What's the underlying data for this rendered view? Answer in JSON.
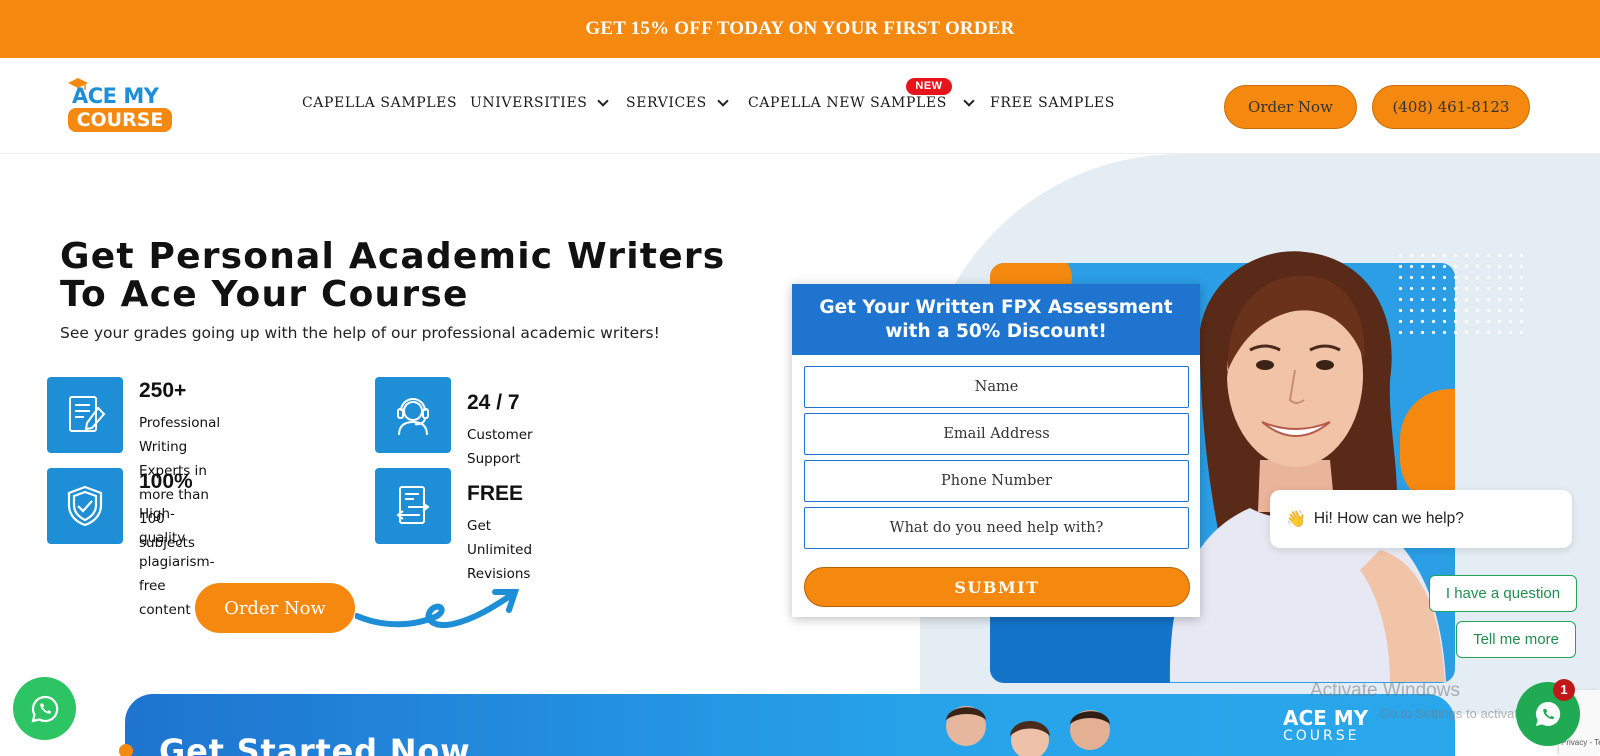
{
  "promo": {
    "text": "GET 15% OFF TODAY ON YOUR FIRST ORDER"
  },
  "logo": {
    "line1": "ACE MY",
    "line2": "COURSE"
  },
  "nav": {
    "items": [
      {
        "label": "CAPELLA SAMPLES",
        "dropdown": false
      },
      {
        "label": "UNIVERSITIES",
        "dropdown": true
      },
      {
        "label": "SERVICES",
        "dropdown": true
      },
      {
        "label": "CAPELLA NEW SAMPLES",
        "dropdown": true
      },
      {
        "label": "FREE SAMPLES",
        "dropdown": false
      }
    ],
    "new_badge": "NEW"
  },
  "header": {
    "order_label": "Order Now",
    "phone_label": "(408) 461-8123"
  },
  "hero": {
    "title_line1": "Get Personal Academic Writers",
    "title_line2": "To Ace Your Course",
    "subtitle": "See your grades going up with the help of our professional academic writers!",
    "features": [
      {
        "icon": "document-pen-icon",
        "number": "250+",
        "text_line1": "Professional Writing Experts in",
        "text_line2": "more than 100 subjects"
      },
      {
        "icon": "headset-support-icon",
        "number": "24 / 7",
        "text_line1": "Customer Support",
        "text_line2": ""
      },
      {
        "icon": "shield-check-icon",
        "number": "100%",
        "text_line1": "High-quality plagiarism-free",
        "text_line2": "content"
      },
      {
        "icon": "revision-document-icon",
        "number": "FREE",
        "text_line1": "Get Unlimited Revisions",
        "text_line2": ""
      }
    ],
    "order_label": "Order Now"
  },
  "form": {
    "title_line1": "Get Your Written FPX Assessment",
    "title_line2": "with a 50% Discount!",
    "fields": {
      "name": {
        "placeholder": "Name",
        "value": ""
      },
      "email": {
        "placeholder": "Email Address",
        "value": ""
      },
      "phone": {
        "placeholder": "Phone Number",
        "value": ""
      },
      "help": {
        "placeholder": "What do you need help with?",
        "value": ""
      }
    },
    "submit_label": "SUBMIT"
  },
  "chat": {
    "greeting_emoji": "👋",
    "greeting": "Hi! How can we help?",
    "option1": "I have a question",
    "option2": "Tell me more",
    "unread_count": "1"
  },
  "watermark": {
    "line1": "Activate Windows",
    "line2": "Go to Settings to activate Windows."
  },
  "recaptcha": {
    "text": "Privacy - Terms"
  },
  "band": {
    "title": "Get Started Now",
    "logo_line1": "ACE MY",
    "logo_line2": "COURSE"
  },
  "colors": {
    "accent_orange": "#f5890f",
    "brand_blue": "#1e74cf",
    "light_blue": "#1e8fd6",
    "whatsapp_green": "#2dc563",
    "badge_red": "#e7151b"
  }
}
